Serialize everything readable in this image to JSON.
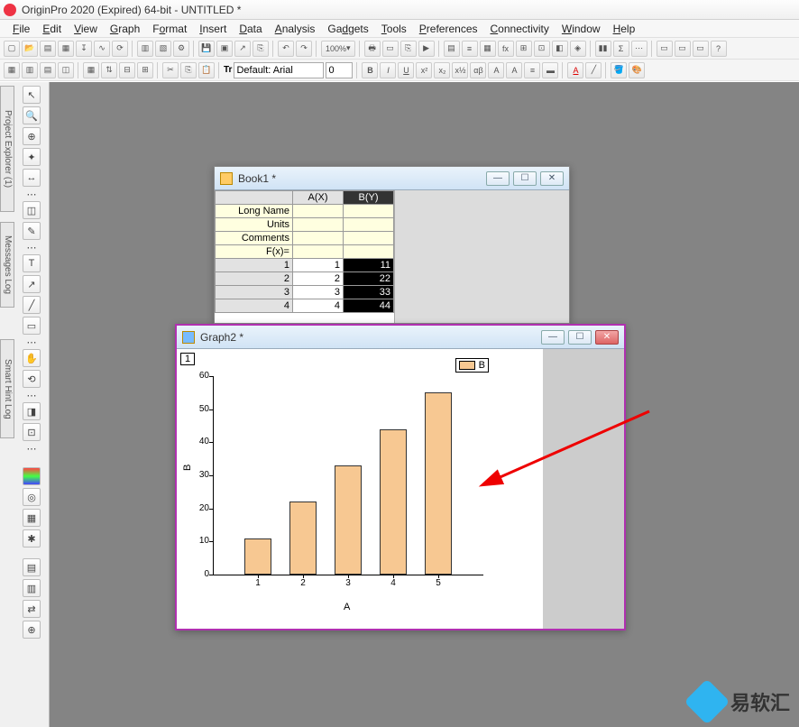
{
  "app": {
    "title": "OriginPro 2020 (Expired) 64-bit - UNTITLED *"
  },
  "menu": [
    "File",
    "Edit",
    "View",
    "Graph",
    "Format",
    "Insert",
    "Data",
    "Analysis",
    "Gadgets",
    "Tools",
    "Preferences",
    "Connectivity",
    "Window",
    "Help"
  ],
  "toolbar2": {
    "font_label": "Tr",
    "font_name": "Default: Arial",
    "font_size": "0",
    "zoom": "100%"
  },
  "side_tabs": {
    "t1": "Project Explorer (1)",
    "t2": "Messages Log",
    "t3": "Smart Hint Log"
  },
  "book": {
    "title": "Book1 *",
    "col_a": "A(X)",
    "col_b": "B(Y)",
    "r_longname": "Long Name",
    "r_units": "Units",
    "r_comments": "Comments",
    "r_fx": "F(x)=",
    "rows": [
      {
        "n": "1",
        "a": "1",
        "b": "11"
      },
      {
        "n": "2",
        "a": "2",
        "b": "22"
      },
      {
        "n": "3",
        "a": "3",
        "b": "33"
      },
      {
        "n": "4",
        "a": "4",
        "b": "44"
      }
    ]
  },
  "graph": {
    "title": "Graph2 *",
    "layer": "1",
    "legend": "B",
    "xlabel": "A",
    "ylabel": "B"
  },
  "chart_data": {
    "type": "bar",
    "categories": [
      "1",
      "2",
      "3",
      "4",
      "5"
    ],
    "values": [
      11,
      22,
      33,
      44,
      55
    ],
    "title": "",
    "xlabel": "A",
    "ylabel": "B",
    "ylim": [
      0,
      60
    ],
    "yticks": [
      0,
      10,
      20,
      30,
      40,
      50,
      60
    ],
    "legend": [
      "B"
    ],
    "colors": {
      "bar": "#f7c892"
    }
  },
  "watermark": "易软汇"
}
